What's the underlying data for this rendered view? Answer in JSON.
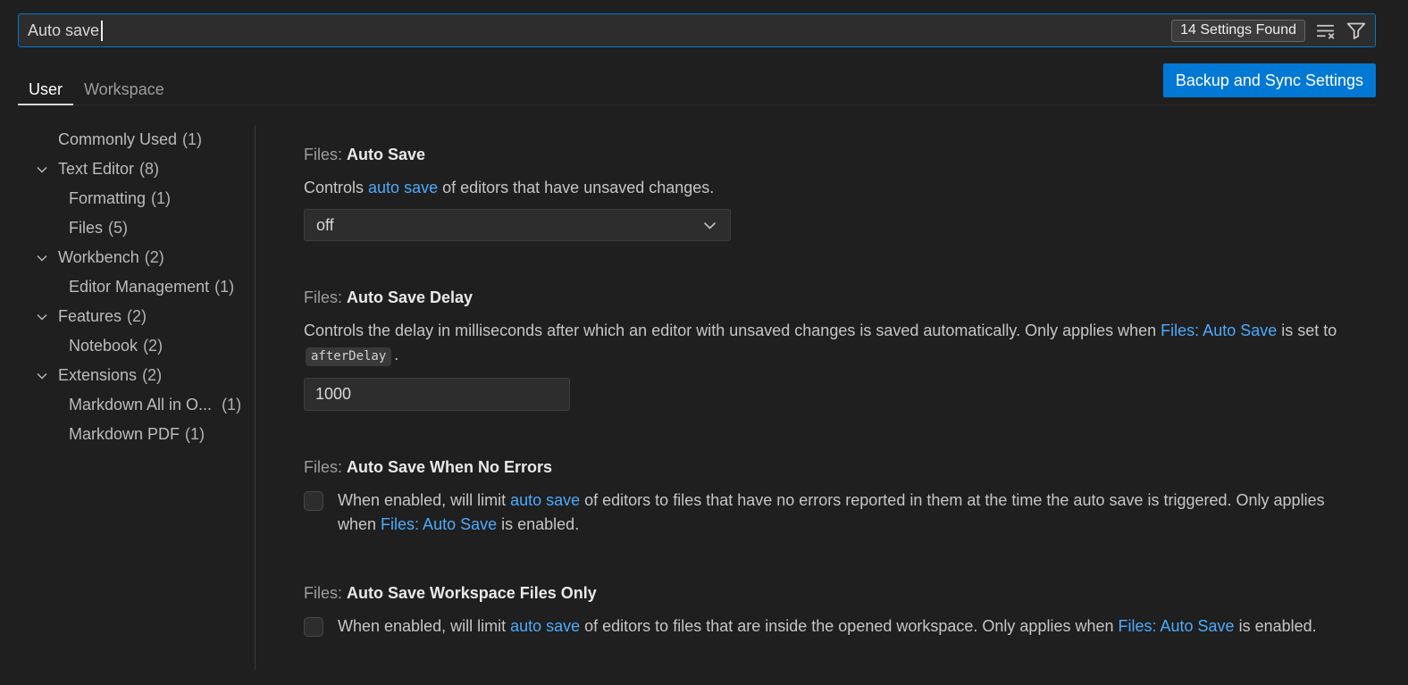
{
  "search": {
    "value": "Auto save",
    "results_badge": "14 Settings Found"
  },
  "header": {
    "tabs": [
      {
        "label": "User",
        "active": true
      },
      {
        "label": "Workspace",
        "active": false
      }
    ],
    "backup_button_label": "Backup and Sync Settings"
  },
  "toc": {
    "items": [
      {
        "label": "Commonly Used",
        "count_label": "(1)",
        "level": 0,
        "expandable": false
      },
      {
        "label": "Text Editor",
        "count_label": "(8)",
        "level": 0,
        "expandable": true
      },
      {
        "label": "Formatting",
        "count_label": "(1)",
        "level": 1,
        "expandable": false
      },
      {
        "label": "Files",
        "count_label": "(5)",
        "level": 1,
        "expandable": false
      },
      {
        "label": "Workbench",
        "count_label": "(2)",
        "level": 0,
        "expandable": true
      },
      {
        "label": "Editor Management",
        "count_label": "(1)",
        "level": 1,
        "expandable": false
      },
      {
        "label": "Features",
        "count_label": "(2)",
        "level": 0,
        "expandable": true
      },
      {
        "label": "Notebook",
        "count_label": "(2)",
        "level": 1,
        "expandable": false
      },
      {
        "label": "Extensions",
        "count_label": "(2)",
        "level": 0,
        "expandable": true
      },
      {
        "label": "Markdown All in O...",
        "count_label": "(1)",
        "level": 1,
        "expandable": false
      },
      {
        "label": "Markdown PDF",
        "count_label": "(1)",
        "level": 1,
        "expandable": false
      }
    ]
  },
  "settings": [
    {
      "category_label": "Files:",
      "name": "Auto Save",
      "description": [
        {
          "type": "text",
          "text": "Controls "
        },
        {
          "type": "link",
          "text": "auto save"
        },
        {
          "type": "text",
          "text": " of editors that have unsaved changes."
        }
      ],
      "control": {
        "type": "select",
        "value": "off"
      }
    },
    {
      "category_label": "Files:",
      "name": "Auto Save Delay",
      "description": [
        {
          "type": "text",
          "text": "Controls the delay in milliseconds after which an editor with unsaved changes is saved automatically. Only applies when "
        },
        {
          "type": "link",
          "text": "Files: Auto Save"
        },
        {
          "type": "text",
          "text": " is set to "
        },
        {
          "type": "code",
          "text": "afterDelay"
        },
        {
          "type": "text",
          "text": "."
        }
      ],
      "control": {
        "type": "number",
        "value": "1000"
      }
    },
    {
      "category_label": "Files:",
      "name": "Auto Save When No Errors",
      "description": [
        {
          "type": "text",
          "text": "When enabled, will limit "
        },
        {
          "type": "link",
          "text": "auto save"
        },
        {
          "type": "text",
          "text": " of editors to files that have no errors reported in them at the time the auto save is triggered. Only applies when "
        },
        {
          "type": "link",
          "text": "Files: Auto Save"
        },
        {
          "type": "text",
          "text": " is enabled."
        }
      ],
      "control": {
        "type": "checkbox",
        "checked": false
      }
    },
    {
      "category_label": "Files:",
      "name": "Auto Save Workspace Files Only",
      "description": [
        {
          "type": "text",
          "text": "When enabled, will limit "
        },
        {
          "type": "link",
          "text": "auto save"
        },
        {
          "type": "text",
          "text": " of editors to files that are inside the opened workspace. Only applies when "
        },
        {
          "type": "link",
          "text": "Files: Auto Save"
        },
        {
          "type": "text",
          "text": " is enabled."
        }
      ],
      "control": {
        "type": "checkbox",
        "checked": false
      }
    }
  ],
  "colors": {
    "accent": "#0078d4",
    "link": "#4daafc",
    "background": "#1f1f1f"
  }
}
